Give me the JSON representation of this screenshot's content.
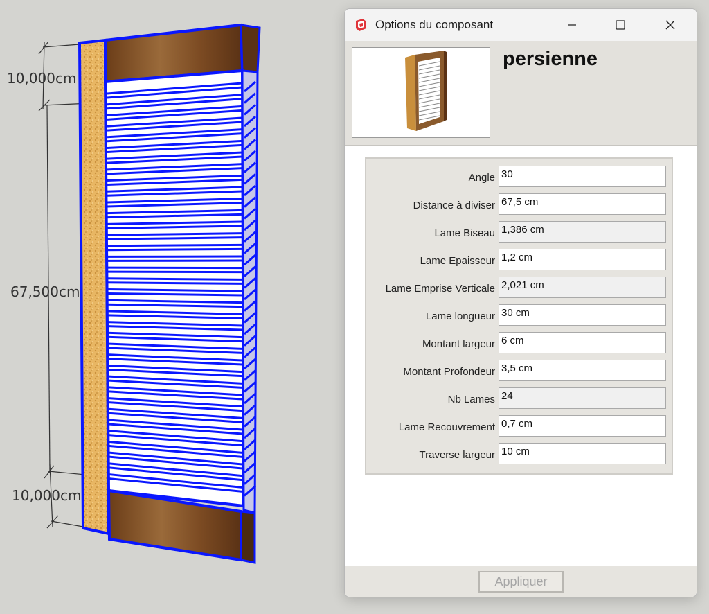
{
  "viewport": {
    "dimensions": [
      "10,000cm",
      "67,500cm",
      "10,000cm"
    ]
  },
  "dialog": {
    "title": "Options du composant",
    "component_name": "persienne",
    "fields": [
      {
        "label": "Angle",
        "value": "30",
        "readonly": false
      },
      {
        "label": "Distance à diviser",
        "value": "67,5 cm",
        "readonly": false
      },
      {
        "label": "Lame Biseau",
        "value": "1,386 cm",
        "readonly": true
      },
      {
        "label": "Lame Epaisseur",
        "value": "1,2 cm",
        "readonly": false
      },
      {
        "label": "Lame Emprise Verticale",
        "value": "2,021 cm",
        "readonly": true
      },
      {
        "label": "Lame longueur",
        "value": "30 cm",
        "readonly": false
      },
      {
        "label": "Montant largeur",
        "value": "6 cm",
        "readonly": false
      },
      {
        "label": "Montant Profondeur",
        "value": "3,5 cm",
        "readonly": false
      },
      {
        "label": "Nb Lames",
        "value": "24",
        "readonly": true
      },
      {
        "label": "Lame Recouvrement",
        "value": "0,7 cm",
        "readonly": false
      },
      {
        "label": "Traverse largeur",
        "value": "10 cm",
        "readonly": false
      }
    ],
    "apply_label": "Appliquer",
    "window_controls": [
      "minimize-icon",
      "maximize-icon",
      "close-icon"
    ]
  },
  "colors": {
    "selection": "#0a17ff",
    "wood_dark": "#7a4a22",
    "wood_end": "#e3b25a",
    "viewport_bg": "#d4d4d0"
  }
}
